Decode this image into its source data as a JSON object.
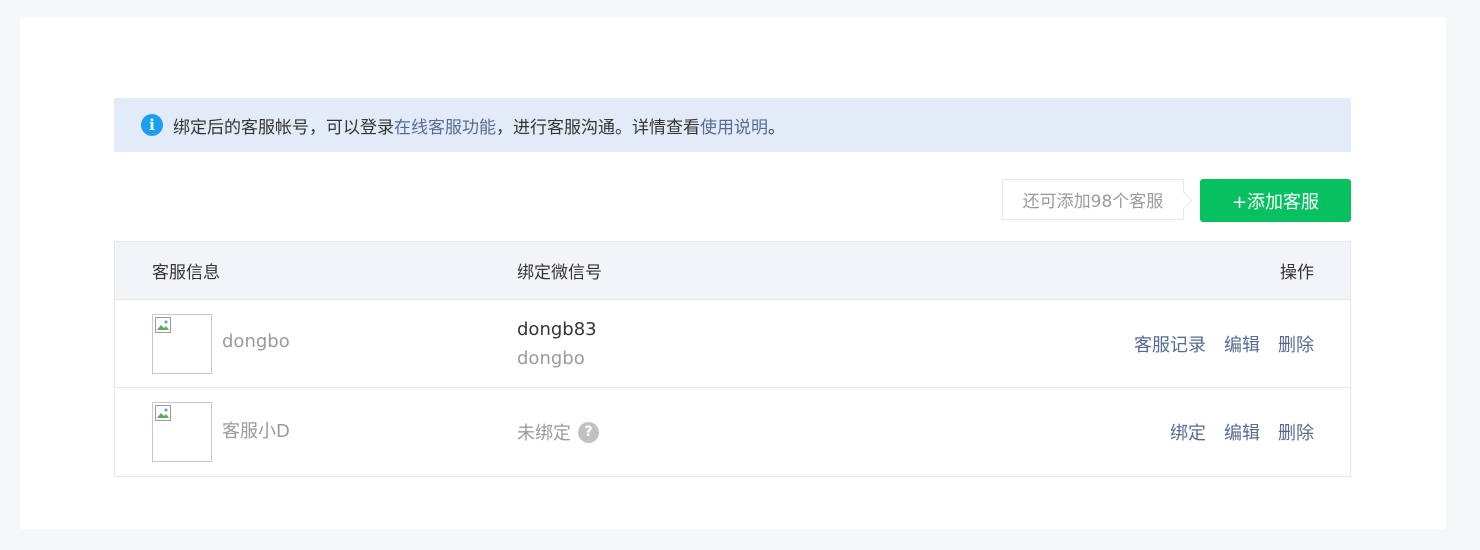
{
  "notice": {
    "text_before": "绑定后的客服帐号，可以登录",
    "link1": "在线客服功能",
    "text_middle": "，进行客服沟通。详情查看",
    "link2": "使用说明",
    "text_after": "。"
  },
  "quota_tip": "还可添加98个客服",
  "add_button": "+添加客服",
  "table": {
    "headers": [
      "客服信息",
      "绑定微信号",
      "操作"
    ],
    "rows": [
      {
        "nickname": "dongbo",
        "wechat_id": "dongb83",
        "wechat_name": "dongbo",
        "actions": [
          "客服记录",
          "编辑",
          "删除"
        ]
      },
      {
        "nickname": "客服小D",
        "status": "未绑定",
        "actions": [
          "绑定",
          "编辑",
          "删除"
        ]
      }
    ]
  },
  "colors": {
    "accent_green": "#07c160",
    "link_blue": "#576b95",
    "info_blue": "#1a9ff3",
    "notice_bg": "#e2ebf7"
  }
}
